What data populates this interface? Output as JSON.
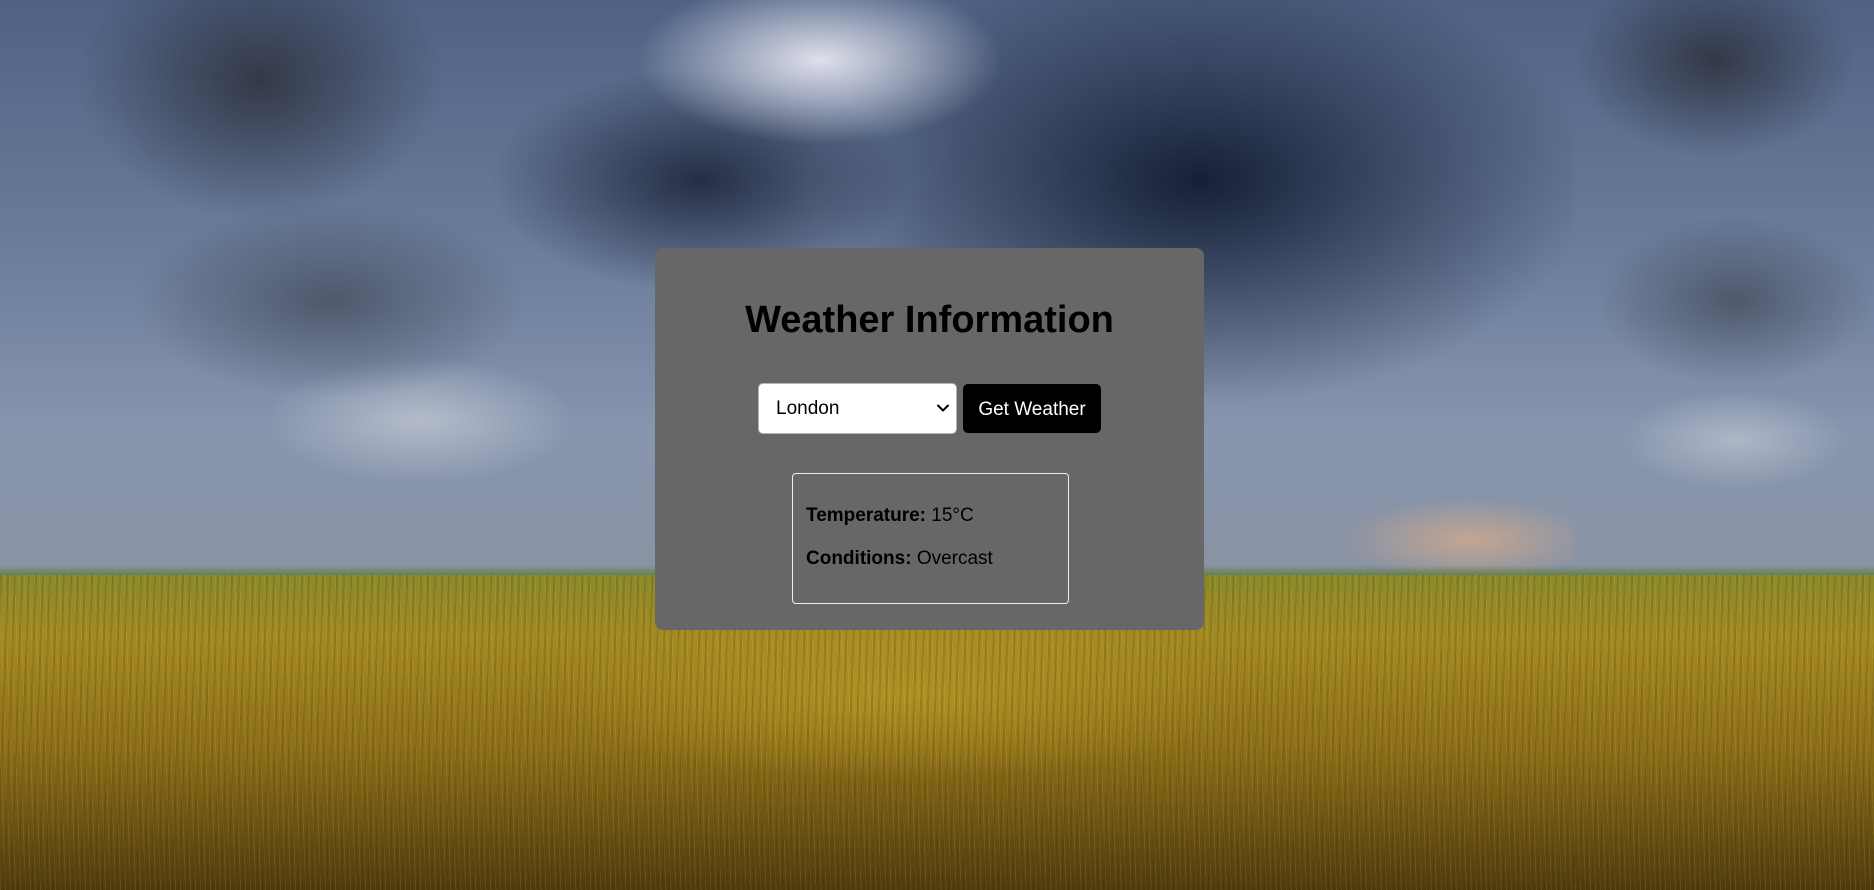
{
  "app": {
    "title": "Weather Information"
  },
  "controls": {
    "city_select": {
      "selected": "London"
    },
    "get_weather_label": "Get Weather"
  },
  "result": {
    "temperature_label": "Temperature:",
    "temperature_value": "15°C",
    "conditions_label": "Conditions:",
    "conditions_value": "Overcast"
  },
  "icons": {
    "select_arrow": "chevron-down-icon"
  },
  "colors": {
    "card_background": "#676767",
    "button_background": "#000000",
    "button_text": "#ffffff",
    "result_border": "#ededed"
  }
}
